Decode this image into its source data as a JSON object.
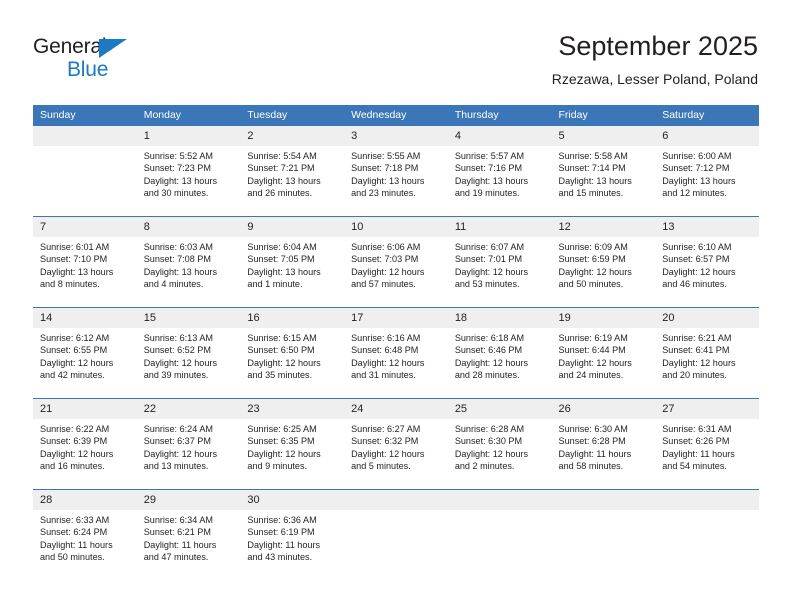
{
  "brand": {
    "name_part1": "General",
    "name_part2": "Blue",
    "accent_color": "#1a7ac4",
    "triangle_icon": "brand-triangle-icon"
  },
  "header": {
    "title": "September 2025",
    "subtitle": "Rzezawa, Lesser Poland, Poland",
    "header_bg_color": "#3a76b8",
    "daynum_bg_color": "#efefef"
  },
  "weekday_headers": [
    "Sunday",
    "Monday",
    "Tuesday",
    "Wednesday",
    "Thursday",
    "Friday",
    "Saturday"
  ],
  "labels": {
    "sunrise": "Sunrise:",
    "sunset": "Sunset:",
    "daylight": "Daylight:"
  },
  "weeks": [
    {
      "days": [
        {
          "num": "",
          "l1": "",
          "l2": "",
          "l3": "",
          "l4": ""
        },
        {
          "num": "1",
          "l1": "Sunrise: 5:52 AM",
          "l2": "Sunset: 7:23 PM",
          "l3": "Daylight: 13 hours",
          "l4": "and 30 minutes."
        },
        {
          "num": "2",
          "l1": "Sunrise: 5:54 AM",
          "l2": "Sunset: 7:21 PM",
          "l3": "Daylight: 13 hours",
          "l4": "and 26 minutes."
        },
        {
          "num": "3",
          "l1": "Sunrise: 5:55 AM",
          "l2": "Sunset: 7:18 PM",
          "l3": "Daylight: 13 hours",
          "l4": "and 23 minutes."
        },
        {
          "num": "4",
          "l1": "Sunrise: 5:57 AM",
          "l2": "Sunset: 7:16 PM",
          "l3": "Daylight: 13 hours",
          "l4": "and 19 minutes."
        },
        {
          "num": "5",
          "l1": "Sunrise: 5:58 AM",
          "l2": "Sunset: 7:14 PM",
          "l3": "Daylight: 13 hours",
          "l4": "and 15 minutes."
        },
        {
          "num": "6",
          "l1": "Sunrise: 6:00 AM",
          "l2": "Sunset: 7:12 PM",
          "l3": "Daylight: 13 hours",
          "l4": "and 12 minutes."
        }
      ]
    },
    {
      "days": [
        {
          "num": "7",
          "l1": "Sunrise: 6:01 AM",
          "l2": "Sunset: 7:10 PM",
          "l3": "Daylight: 13 hours",
          "l4": "and 8 minutes."
        },
        {
          "num": "8",
          "l1": "Sunrise: 6:03 AM",
          "l2": "Sunset: 7:08 PM",
          "l3": "Daylight: 13 hours",
          "l4": "and 4 minutes."
        },
        {
          "num": "9",
          "l1": "Sunrise: 6:04 AM",
          "l2": "Sunset: 7:05 PM",
          "l3": "Daylight: 13 hours",
          "l4": "and 1 minute."
        },
        {
          "num": "10",
          "l1": "Sunrise: 6:06 AM",
          "l2": "Sunset: 7:03 PM",
          "l3": "Daylight: 12 hours",
          "l4": "and 57 minutes."
        },
        {
          "num": "11",
          "l1": "Sunrise: 6:07 AM",
          "l2": "Sunset: 7:01 PM",
          "l3": "Daylight: 12 hours",
          "l4": "and 53 minutes."
        },
        {
          "num": "12",
          "l1": "Sunrise: 6:09 AM",
          "l2": "Sunset: 6:59 PM",
          "l3": "Daylight: 12 hours",
          "l4": "and 50 minutes."
        },
        {
          "num": "13",
          "l1": "Sunrise: 6:10 AM",
          "l2": "Sunset: 6:57 PM",
          "l3": "Daylight: 12 hours",
          "l4": "and 46 minutes."
        }
      ]
    },
    {
      "days": [
        {
          "num": "14",
          "l1": "Sunrise: 6:12 AM",
          "l2": "Sunset: 6:55 PM",
          "l3": "Daylight: 12 hours",
          "l4": "and 42 minutes."
        },
        {
          "num": "15",
          "l1": "Sunrise: 6:13 AM",
          "l2": "Sunset: 6:52 PM",
          "l3": "Daylight: 12 hours",
          "l4": "and 39 minutes."
        },
        {
          "num": "16",
          "l1": "Sunrise: 6:15 AM",
          "l2": "Sunset: 6:50 PM",
          "l3": "Daylight: 12 hours",
          "l4": "and 35 minutes."
        },
        {
          "num": "17",
          "l1": "Sunrise: 6:16 AM",
          "l2": "Sunset: 6:48 PM",
          "l3": "Daylight: 12 hours",
          "l4": "and 31 minutes."
        },
        {
          "num": "18",
          "l1": "Sunrise: 6:18 AM",
          "l2": "Sunset: 6:46 PM",
          "l3": "Daylight: 12 hours",
          "l4": "and 28 minutes."
        },
        {
          "num": "19",
          "l1": "Sunrise: 6:19 AM",
          "l2": "Sunset: 6:44 PM",
          "l3": "Daylight: 12 hours",
          "l4": "and 24 minutes."
        },
        {
          "num": "20",
          "l1": "Sunrise: 6:21 AM",
          "l2": "Sunset: 6:41 PM",
          "l3": "Daylight: 12 hours",
          "l4": "and 20 minutes."
        }
      ]
    },
    {
      "days": [
        {
          "num": "21",
          "l1": "Sunrise: 6:22 AM",
          "l2": "Sunset: 6:39 PM",
          "l3": "Daylight: 12 hours",
          "l4": "and 16 minutes."
        },
        {
          "num": "22",
          "l1": "Sunrise: 6:24 AM",
          "l2": "Sunset: 6:37 PM",
          "l3": "Daylight: 12 hours",
          "l4": "and 13 minutes."
        },
        {
          "num": "23",
          "l1": "Sunrise: 6:25 AM",
          "l2": "Sunset: 6:35 PM",
          "l3": "Daylight: 12 hours",
          "l4": "and 9 minutes."
        },
        {
          "num": "24",
          "l1": "Sunrise: 6:27 AM",
          "l2": "Sunset: 6:32 PM",
          "l3": "Daylight: 12 hours",
          "l4": "and 5 minutes."
        },
        {
          "num": "25",
          "l1": "Sunrise: 6:28 AM",
          "l2": "Sunset: 6:30 PM",
          "l3": "Daylight: 12 hours",
          "l4": "and 2 minutes."
        },
        {
          "num": "26",
          "l1": "Sunrise: 6:30 AM",
          "l2": "Sunset: 6:28 PM",
          "l3": "Daylight: 11 hours",
          "l4": "and 58 minutes."
        },
        {
          "num": "27",
          "l1": "Sunrise: 6:31 AM",
          "l2": "Sunset: 6:26 PM",
          "l3": "Daylight: 11 hours",
          "l4": "and 54 minutes."
        }
      ]
    },
    {
      "days": [
        {
          "num": "28",
          "l1": "Sunrise: 6:33 AM",
          "l2": "Sunset: 6:24 PM",
          "l3": "Daylight: 11 hours",
          "l4": "and 50 minutes."
        },
        {
          "num": "29",
          "l1": "Sunrise: 6:34 AM",
          "l2": "Sunset: 6:21 PM",
          "l3": "Daylight: 11 hours",
          "l4": "and 47 minutes."
        },
        {
          "num": "30",
          "l1": "Sunrise: 6:36 AM",
          "l2": "Sunset: 6:19 PM",
          "l3": "Daylight: 11 hours",
          "l4": "and 43 minutes."
        },
        {
          "num": "",
          "l1": "",
          "l2": "",
          "l3": "",
          "l4": ""
        },
        {
          "num": "",
          "l1": "",
          "l2": "",
          "l3": "",
          "l4": ""
        },
        {
          "num": "",
          "l1": "",
          "l2": "",
          "l3": "",
          "l4": ""
        },
        {
          "num": "",
          "l1": "",
          "l2": "",
          "l3": "",
          "l4": ""
        }
      ]
    }
  ]
}
